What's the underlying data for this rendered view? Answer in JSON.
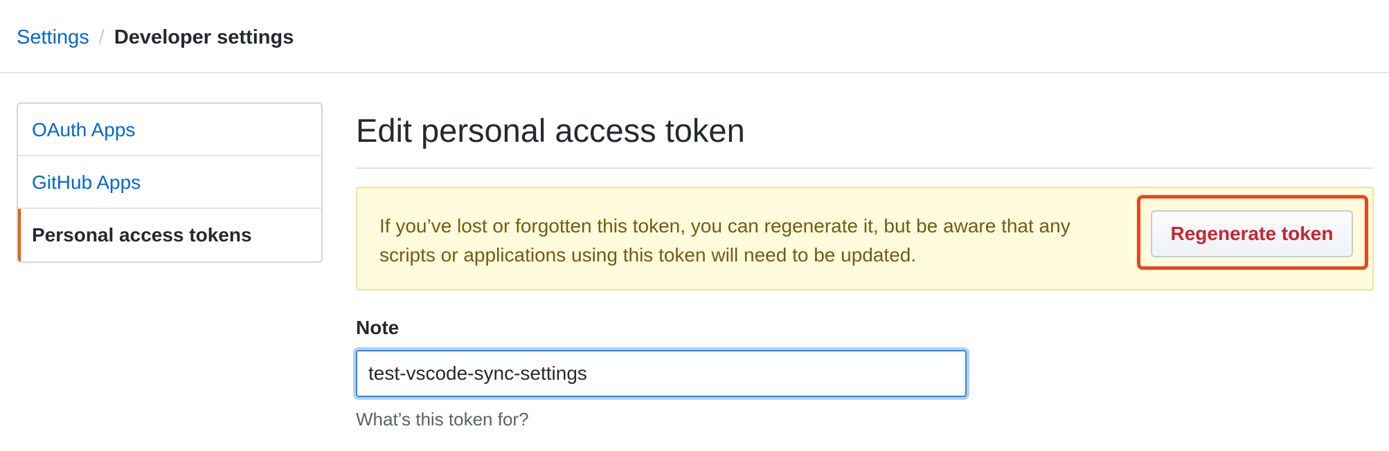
{
  "breadcrumb": {
    "parent": "Settings",
    "separator": "/",
    "current": "Developer settings"
  },
  "sidebar": {
    "items": [
      {
        "label": "OAuth Apps",
        "selected": false
      },
      {
        "label": "GitHub Apps",
        "selected": false
      },
      {
        "label": "Personal access tokens",
        "selected": true
      }
    ]
  },
  "main": {
    "title": "Edit personal access token",
    "flash": {
      "message": "If you’ve lost or forgotten this token, you can regenerate it, but be aware that any scripts or applications using this token will need to be updated.",
      "button_label": "Regenerate token"
    },
    "note": {
      "label": "Note",
      "value": "test-vscode-sync-settings",
      "help": "What’s this token for?"
    }
  },
  "colors": {
    "link": "#0366d6",
    "selected_accent": "#e36209",
    "flash_bg": "#fffbdd",
    "flash_text": "#735c0f",
    "danger": "#cb2431",
    "highlight": "#e8461f",
    "focus": "#2188ff"
  }
}
